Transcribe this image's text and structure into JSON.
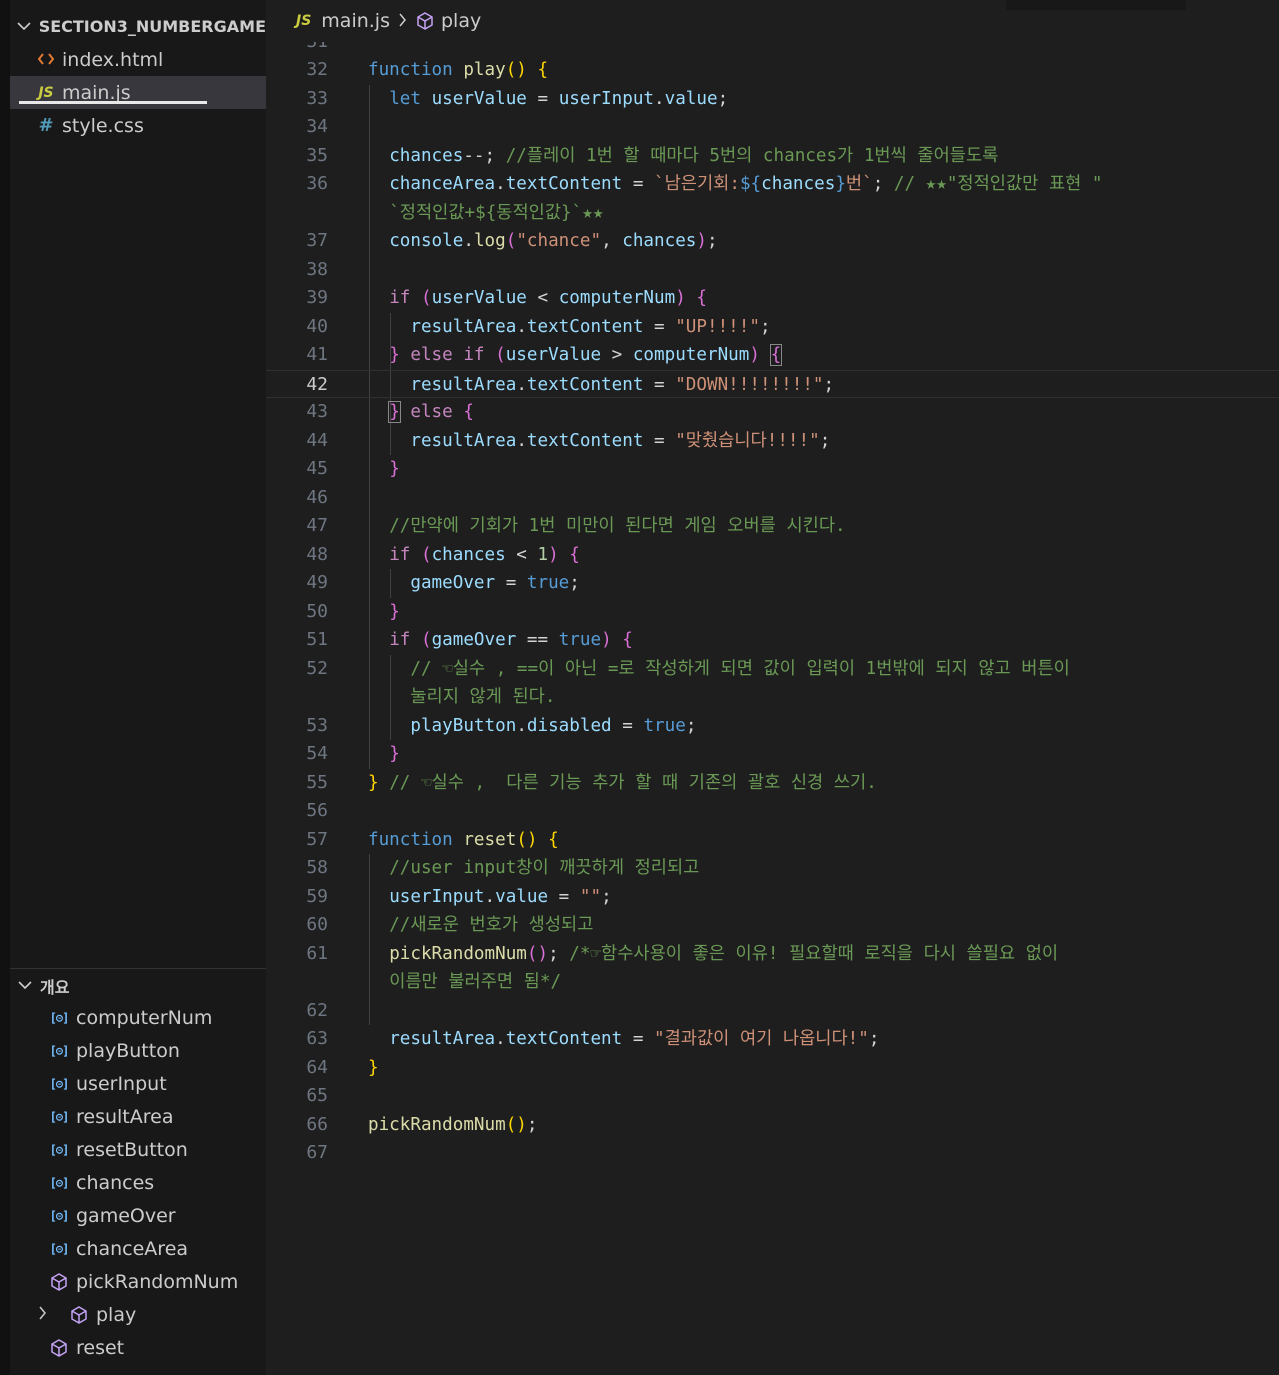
{
  "sidebar": {
    "explorer_title": "SECTION3_NUMBERGAME",
    "files": [
      {
        "icon": "html-icon",
        "name": "index.html"
      },
      {
        "icon": "js-icon",
        "name": "main.js"
      },
      {
        "icon": "css-icon",
        "name": "style.css"
      }
    ],
    "js_badge": "JS",
    "css_badge": "#",
    "outline_title": "개요",
    "outline": [
      {
        "kind": "variable",
        "name": "computerNum"
      },
      {
        "kind": "variable",
        "name": "playButton"
      },
      {
        "kind": "variable",
        "name": "userInput"
      },
      {
        "kind": "variable",
        "name": "resultArea"
      },
      {
        "kind": "variable",
        "name": "resetButton"
      },
      {
        "kind": "variable",
        "name": "chances"
      },
      {
        "kind": "variable",
        "name": "gameOver"
      },
      {
        "kind": "variable",
        "name": "chanceArea"
      },
      {
        "kind": "function",
        "name": "pickRandomNum"
      },
      {
        "kind": "function",
        "name": "play",
        "collapsed": true
      },
      {
        "kind": "function",
        "name": "reset"
      }
    ]
  },
  "breadcrumb": {
    "badge": "JS",
    "file": "main.js",
    "symbol": "play"
  },
  "editor": {
    "partial_line_number": "31",
    "current_line": "42",
    "lines": [
      {
        "n": "32",
        "t": [
          [
            "kw",
            "function "
          ],
          [
            "fn",
            "play"
          ],
          [
            "b1",
            "() {"
          ]
        ]
      },
      {
        "n": "33",
        "t": [
          [
            "",
            "  "
          ],
          [
            "kw",
            "let "
          ],
          [
            "var",
            "userValue"
          ],
          [
            "",
            " = "
          ],
          [
            "var",
            "userInput"
          ],
          [
            "",
            "."
          ],
          [
            "var",
            "value"
          ],
          [
            "",
            ";"
          ]
        ]
      },
      {
        "n": "34",
        "t": []
      },
      {
        "n": "35",
        "t": [
          [
            "",
            "  "
          ],
          [
            "var",
            "chances"
          ],
          [
            "",
            "--; "
          ],
          [
            "cmt",
            "//플레이 1번 할 때마다 5번의 chances가 1번씩 줄어들도록"
          ]
        ]
      },
      {
        "n": "36",
        "t": [
          [
            "",
            "  "
          ],
          [
            "var",
            "chanceArea"
          ],
          [
            "",
            "."
          ],
          [
            "var",
            "textContent"
          ],
          [
            "",
            " = "
          ],
          [
            "str",
            "`남은기회:"
          ],
          [
            "kw",
            "${"
          ],
          [
            "var",
            "chances"
          ],
          [
            "kw",
            "}"
          ],
          [
            "str",
            "번`"
          ],
          [
            "",
            "; "
          ],
          [
            "cmt",
            "// ★★\"정적인값만 표현 \""
          ]
        ]
      },
      {
        "n": "",
        "t": [
          [
            "",
            "  "
          ],
          [
            "cmt",
            "`정적인값+${동적인값}`★★"
          ]
        ]
      },
      {
        "n": "37",
        "t": [
          [
            "",
            "  "
          ],
          [
            "var",
            "console"
          ],
          [
            "",
            "."
          ],
          [
            "fn",
            "log"
          ],
          [
            "b2",
            "("
          ],
          [
            "str",
            "\"chance\""
          ],
          [
            "",
            ", "
          ],
          [
            "var",
            "chances"
          ],
          [
            "b2",
            ")"
          ],
          [
            "",
            ";"
          ]
        ]
      },
      {
        "n": "38",
        "t": []
      },
      {
        "n": "39",
        "t": [
          [
            "",
            "  "
          ],
          [
            "ctl",
            "if "
          ],
          [
            "b2",
            "("
          ],
          [
            "var",
            "userValue"
          ],
          [
            "",
            " < "
          ],
          [
            "var",
            "computerNum"
          ],
          [
            "b2",
            ")"
          ],
          [
            "",
            " "
          ],
          [
            "b2",
            "{"
          ]
        ]
      },
      {
        "n": "40",
        "t": [
          [
            "",
            "    "
          ],
          [
            "var",
            "resultArea"
          ],
          [
            "",
            "."
          ],
          [
            "var",
            "textContent"
          ],
          [
            "",
            " = "
          ],
          [
            "str",
            "\"UP!!!!\""
          ],
          [
            "",
            ";"
          ]
        ]
      },
      {
        "n": "41",
        "t": [
          [
            "",
            "  "
          ],
          [
            "b2",
            "}"
          ],
          [
            "",
            " "
          ],
          [
            "ctl",
            "else if "
          ],
          [
            "b2",
            "("
          ],
          [
            "var",
            "userValue"
          ],
          [
            "",
            " > "
          ],
          [
            "var",
            "computerNum"
          ],
          [
            "b2",
            ")"
          ],
          [
            "",
            " "
          ],
          [
            "b2 bm",
            "{"
          ]
        ]
      },
      {
        "n": "42",
        "t": [
          [
            "",
            "    "
          ],
          [
            "var",
            "resultArea"
          ],
          [
            "",
            "."
          ],
          [
            "var",
            "textContent"
          ],
          [
            "",
            " = "
          ],
          [
            "str",
            "\"DOWN!!!!!!!!\""
          ],
          [
            "",
            ";"
          ]
        ]
      },
      {
        "n": "43",
        "t": [
          [
            "",
            "  "
          ],
          [
            "b2 bm",
            "}"
          ],
          [
            "",
            " "
          ],
          [
            "ctl",
            "else "
          ],
          [
            "b2",
            "{"
          ]
        ]
      },
      {
        "n": "44",
        "t": [
          [
            "",
            "    "
          ],
          [
            "var",
            "resultArea"
          ],
          [
            "",
            "."
          ],
          [
            "var",
            "textContent"
          ],
          [
            "",
            " = "
          ],
          [
            "str",
            "\"맞췄습니다!!!!\""
          ],
          [
            "",
            ";"
          ]
        ]
      },
      {
        "n": "45",
        "t": [
          [
            "",
            "  "
          ],
          [
            "b2",
            "}"
          ]
        ]
      },
      {
        "n": "46",
        "t": []
      },
      {
        "n": "47",
        "t": [
          [
            "",
            "  "
          ],
          [
            "cmt",
            "//만약에 기회가 1번 미만이 된다면 게임 오버를 시킨다."
          ]
        ]
      },
      {
        "n": "48",
        "t": [
          [
            "",
            "  "
          ],
          [
            "ctl",
            "if "
          ],
          [
            "b2",
            "("
          ],
          [
            "var",
            "chances"
          ],
          [
            "",
            " < "
          ],
          [
            "num",
            "1"
          ],
          [
            "b2",
            ")"
          ],
          [
            "",
            " "
          ],
          [
            "b2",
            "{"
          ]
        ]
      },
      {
        "n": "49",
        "t": [
          [
            "",
            "    "
          ],
          [
            "var",
            "gameOver"
          ],
          [
            "",
            " = "
          ],
          [
            "kw",
            "true"
          ],
          [
            "",
            ";"
          ]
        ]
      },
      {
        "n": "50",
        "t": [
          [
            "",
            "  "
          ],
          [
            "b2",
            "}"
          ]
        ]
      },
      {
        "n": "51",
        "t": [
          [
            "",
            "  "
          ],
          [
            "ctl",
            "if "
          ],
          [
            "b2",
            "("
          ],
          [
            "var",
            "gameOver"
          ],
          [
            "",
            " == "
          ],
          [
            "kw",
            "true"
          ],
          [
            "b2",
            ")"
          ],
          [
            "",
            " "
          ],
          [
            "b2",
            "{"
          ]
        ]
      },
      {
        "n": "52",
        "t": [
          [
            "",
            "    "
          ],
          [
            "cmt",
            "// ☜실수 , ==이 아닌 =로 작성하게 되면 값이 입력이 1번밖에 되지 않고 버튼이"
          ]
        ]
      },
      {
        "n": "",
        "t": [
          [
            "",
            "    "
          ],
          [
            "cmt",
            "눌리지 않게 된다."
          ]
        ]
      },
      {
        "n": "53",
        "t": [
          [
            "",
            "    "
          ],
          [
            "var",
            "playButton"
          ],
          [
            "",
            "."
          ],
          [
            "var",
            "disabled"
          ],
          [
            "",
            " = "
          ],
          [
            "kw",
            "true"
          ],
          [
            "",
            ";"
          ]
        ]
      },
      {
        "n": "54",
        "t": [
          [
            "",
            "  "
          ],
          [
            "b2",
            "}"
          ]
        ]
      },
      {
        "n": "55",
        "t": [
          [
            "b1",
            "}"
          ],
          [
            "",
            " "
          ],
          [
            "cmt",
            "// ☜실수 ,  다른 기능 추가 할 때 기존의 괄호 신경 쓰기."
          ]
        ]
      },
      {
        "n": "56",
        "t": []
      },
      {
        "n": "57",
        "t": [
          [
            "kw",
            "function "
          ],
          [
            "fn",
            "reset"
          ],
          [
            "b1",
            "() {"
          ]
        ]
      },
      {
        "n": "58",
        "t": [
          [
            "",
            "  "
          ],
          [
            "cmt",
            "//user input창이 깨끗하게 정리되고"
          ]
        ]
      },
      {
        "n": "59",
        "t": [
          [
            "",
            "  "
          ],
          [
            "var",
            "userInput"
          ],
          [
            "",
            "."
          ],
          [
            "var",
            "value"
          ],
          [
            "",
            " = "
          ],
          [
            "str",
            "\"\""
          ],
          [
            "",
            ";"
          ]
        ]
      },
      {
        "n": "60",
        "t": [
          [
            "",
            "  "
          ],
          [
            "cmt",
            "//새로운 번호가 생성되고"
          ]
        ]
      },
      {
        "n": "61",
        "t": [
          [
            "",
            "  "
          ],
          [
            "fn",
            "pickRandomNum"
          ],
          [
            "b2",
            "()"
          ],
          [
            "",
            "; "
          ],
          [
            "cmt",
            "/*☞함수사용이 좋은 이유! 필요할때 로직을 다시 쓸필요 없이"
          ]
        ]
      },
      {
        "n": "",
        "t": [
          [
            "",
            "  "
          ],
          [
            "cmt",
            "이름만 불러주면 됨*/"
          ]
        ]
      },
      {
        "n": "62",
        "t": []
      },
      {
        "n": "63",
        "t": [
          [
            "",
            "  "
          ],
          [
            "var",
            "resultArea"
          ],
          [
            "",
            "."
          ],
          [
            "var",
            "textContent"
          ],
          [
            "",
            " = "
          ],
          [
            "str",
            "\"결과값이 여기 나옵니다!\""
          ],
          [
            "",
            ";"
          ]
        ]
      },
      {
        "n": "64",
        "t": [
          [
            "b1",
            "}"
          ]
        ]
      },
      {
        "n": "65",
        "t": []
      },
      {
        "n": "66",
        "t": [
          [
            "fn",
            "pickRandomNum"
          ],
          [
            "b1",
            "()"
          ],
          [
            "",
            ";"
          ]
        ]
      },
      {
        "n": "67",
        "t": []
      }
    ]
  }
}
